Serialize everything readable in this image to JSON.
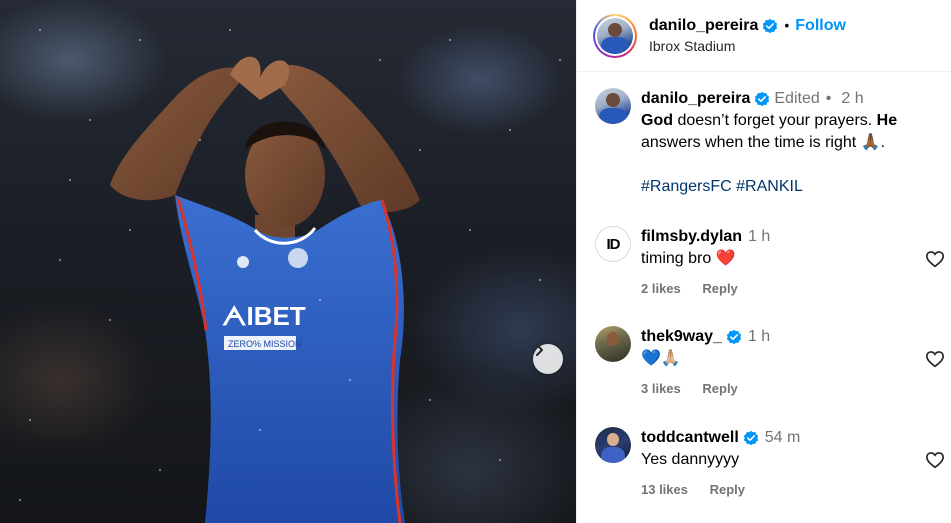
{
  "post": {
    "username": "danilo_pereira",
    "follow_label": "Follow",
    "location": "Ibrox Stadium",
    "caption": {
      "username": "danilo_pereira",
      "edited_label": "Edited",
      "time": "2 h",
      "word_god": "God",
      "text_1": " doesn’t forget your prayers. ",
      "word_he": "He",
      "text_2": " answers when the time is right ",
      "emoji_pray": "🙏🏾",
      "text_end": ".",
      "hashtags": "#RangersFC #RANKIL"
    },
    "media": {
      "sponsor": "ᗅIBET",
      "shirt_strip": "ZERO% MISSION"
    }
  },
  "comments": [
    {
      "username": "filmsby.dylan",
      "verified": false,
      "time": "1 h",
      "text": "timing bro",
      "emoji": "❤️",
      "likes": "2 likes",
      "reply_label": "Reply",
      "avatar_text": "ID"
    },
    {
      "username": "thek9way_",
      "verified": true,
      "time": "1 h",
      "text": "",
      "emoji": "💙🙏🏼",
      "likes": "3 likes",
      "reply_label": "Reply"
    },
    {
      "username": "toddcantwell",
      "verified": true,
      "time": "54 m",
      "text": "Yes dannyyyy",
      "emoji": "",
      "likes": "13 likes",
      "reply_label": "Reply"
    }
  ],
  "colors": {
    "link": "#0095f6",
    "hashtag": "#00376b",
    "muted": "#737373",
    "verified": "#0095f6",
    "heart": "#e0245e"
  },
  "icons": {
    "verified": "verified-badge-icon",
    "next": "chevron-right-icon",
    "like": "heart-outline-icon",
    "more": "more-options-icon"
  }
}
